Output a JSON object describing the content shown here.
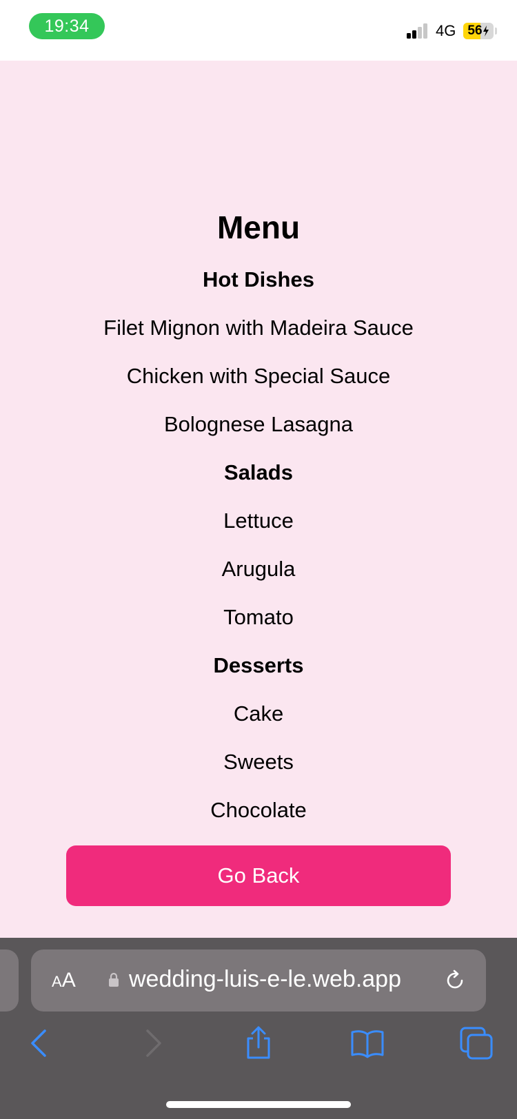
{
  "status_bar": {
    "time": "19:34",
    "network": "4G",
    "battery_percent": "56",
    "battery_level": 0.56,
    "colors": {
      "time_pill": "#34c759",
      "battery_charging": "#ffd60a"
    }
  },
  "page": {
    "background": "#fbe6f0",
    "title": "Menu",
    "sections": [
      {
        "heading": "Hot Dishes",
        "items": [
          "Filet Mignon with Madeira Sauce",
          "Chicken with Special Sauce",
          "Bolognese Lasagna"
        ]
      },
      {
        "heading": "Salads",
        "items": [
          "Lettuce",
          "Arugula",
          "Tomato"
        ]
      },
      {
        "heading": "Desserts",
        "items": [
          "Cake",
          "Sweets",
          "Chocolate"
        ]
      }
    ],
    "go_back_label": "Go Back",
    "accent": "#f02b7c"
  },
  "browser": {
    "text_size_label_small": "A",
    "text_size_label_big": "A",
    "url": "wedding-luis-e-le.web.app",
    "icons": [
      "lock-icon",
      "reload-icon",
      "back-icon",
      "forward-icon",
      "share-icon",
      "bookmarks-icon",
      "tabs-icon"
    ]
  }
}
